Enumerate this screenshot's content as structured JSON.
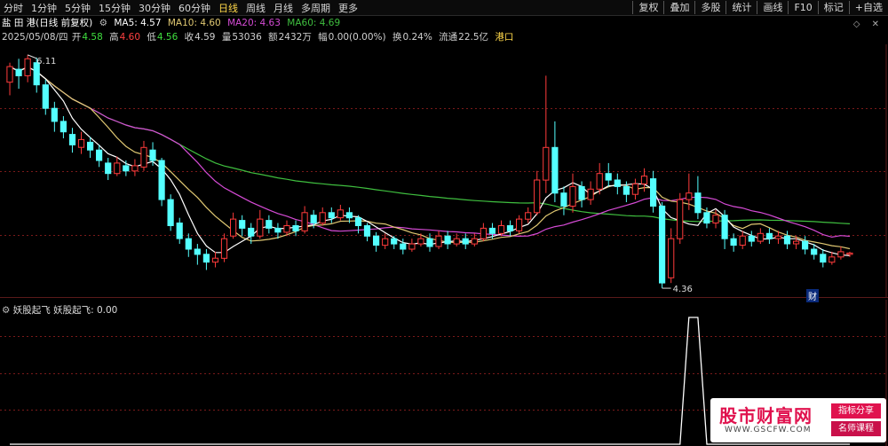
{
  "toolbar": {
    "periods": [
      "分时",
      "1分钟",
      "5分钟",
      "15分钟",
      "30分钟",
      "60分钟",
      "日线",
      "周线",
      "月线",
      "多周期",
      "更多"
    ],
    "active_period": "日线",
    "buttons": [
      "复权",
      "叠加",
      "多股",
      "统计",
      "画线",
      "F10",
      "标记",
      "+自选"
    ]
  },
  "stock": {
    "name": "盐 田 港(日线 前复权)",
    "ma5_label": "MA5: 4.57",
    "ma10_label": "MA10: 4.60",
    "ma20_label": "MA20: 4.63",
    "ma60_label": "MA60: 4.69"
  },
  "quote": {
    "date": "2025/05/08/四",
    "open_label": "开",
    "open": "4.58",
    "high_label": "高",
    "high": "4.60",
    "low_label": "低",
    "low": "4.56",
    "close_label": "收",
    "close": "4.59",
    "volume_label": "量",
    "volume": "53036",
    "amount_label": "额",
    "amount": "2432万",
    "change_label": "幅",
    "change": "0.00(0.00%)",
    "turnover_label": "换",
    "turnover": "0.24%",
    "float_label": "流通",
    "float": "22.5亿",
    "sector": "港口"
  },
  "annotations": {
    "max_price": "6.11",
    "min_price": "4.36",
    "finance_mark": "财"
  },
  "indicator": {
    "title": "妖股起飞",
    "value_label": "妖股起飞: 0.00"
  },
  "watermark": {
    "main": "股市财富网",
    "url": "WWW.GSCFW.COM",
    "tag1": "指标分享",
    "tag2": "名师课程"
  },
  "colors": {
    "up": "#ff3b3b",
    "down": "#54ffff",
    "ma5": "#ffffff",
    "ma10": "#e0c872",
    "ma20": "#d64bd6",
    "ma60": "#3fbf3f",
    "grid": "#7a1a1a"
  },
  "chart_data": {
    "type": "candlestick",
    "price_range": [
      4.3,
      6.15
    ],
    "candles": [
      [
        5.9,
        6.02,
        5.8,
        6.05
      ],
      [
        6.0,
        5.95,
        5.85,
        6.08
      ],
      [
        5.95,
        6.08,
        5.9,
        6.11
      ],
      [
        6.05,
        5.88,
        5.82,
        6.09
      ],
      [
        5.88,
        5.7,
        5.65,
        5.92
      ],
      [
        5.7,
        5.6,
        5.52,
        5.75
      ],
      [
        5.6,
        5.52,
        5.47,
        5.64
      ],
      [
        5.5,
        5.42,
        5.36,
        5.55
      ],
      [
        5.4,
        5.46,
        5.35,
        5.52
      ],
      [
        5.44,
        5.38,
        5.32,
        5.48
      ],
      [
        5.38,
        5.3,
        5.25,
        5.42
      ],
      [
        5.28,
        5.2,
        5.15,
        5.32
      ],
      [
        5.2,
        5.28,
        5.18,
        5.33
      ],
      [
        5.26,
        5.22,
        5.18,
        5.3
      ],
      [
        5.22,
        5.26,
        5.18,
        5.31
      ],
      [
        5.25,
        5.4,
        5.22,
        5.45
      ],
      [
        5.38,
        5.3,
        5.26,
        5.44
      ],
      [
        5.3,
        5.0,
        4.95,
        5.32
      ],
      [
        5.0,
        4.8,
        4.76,
        5.04
      ],
      [
        4.82,
        4.7,
        4.66,
        4.86
      ],
      [
        4.7,
        4.62,
        4.56,
        4.74
      ],
      [
        4.62,
        4.58,
        4.5,
        4.66
      ],
      [
        4.58,
        4.52,
        4.46,
        4.62
      ],
      [
        4.52,
        4.55,
        4.48,
        4.6
      ],
      [
        4.55,
        4.7,
        4.52,
        4.74
      ],
      [
        4.72,
        4.85,
        4.7,
        4.9
      ],
      [
        4.84,
        4.78,
        4.72,
        4.88
      ],
      [
        4.78,
        4.72,
        4.66,
        4.82
      ],
      [
        4.72,
        4.85,
        4.7,
        4.92
      ],
      [
        4.84,
        4.78,
        4.74,
        4.88
      ],
      [
        4.78,
        4.75,
        4.7,
        4.82
      ],
      [
        4.75,
        4.8,
        4.72,
        4.84
      ],
      [
        4.8,
        4.76,
        4.72,
        4.84
      ],
      [
        4.76,
        4.9,
        4.74,
        4.95
      ],
      [
        4.88,
        4.82,
        4.78,
        4.92
      ],
      [
        4.82,
        4.9,
        4.8,
        4.94
      ],
      [
        4.9,
        4.86,
        4.82,
        4.94
      ],
      [
        4.86,
        4.92,
        4.84,
        4.96
      ],
      [
        4.9,
        4.86,
        4.82,
        4.94
      ],
      [
        4.86,
        4.8,
        4.74,
        4.88
      ],
      [
        4.8,
        4.72,
        4.68,
        4.82
      ],
      [
        4.72,
        4.65,
        4.6,
        4.75
      ],
      [
        4.65,
        4.7,
        4.62,
        4.74
      ],
      [
        4.7,
        4.66,
        4.62,
        4.72
      ],
      [
        4.66,
        4.62,
        4.58,
        4.7
      ],
      [
        4.62,
        4.66,
        4.6,
        4.7
      ],
      [
        4.66,
        4.7,
        4.64,
        4.74
      ],
      [
        4.7,
        4.64,
        4.6,
        4.74
      ],
      [
        4.64,
        4.72,
        4.62,
        4.76
      ],
      [
        4.72,
        4.66,
        4.62,
        4.76
      ],
      [
        4.66,
        4.7,
        4.64,
        4.74
      ],
      [
        4.7,
        4.66,
        4.62,
        4.74
      ],
      [
        4.66,
        4.7,
        4.64,
        4.74
      ],
      [
        4.7,
        4.78,
        4.68,
        4.82
      ],
      [
        4.78,
        4.74,
        4.7,
        4.82
      ],
      [
        4.74,
        4.8,
        4.72,
        4.84
      ],
      [
        4.8,
        4.76,
        4.72,
        4.84
      ],
      [
        4.76,
        4.85,
        4.74,
        4.88
      ],
      [
        4.85,
        4.9,
        4.82,
        4.94
      ],
      [
        4.9,
        5.15,
        4.88,
        5.22
      ],
      [
        5.15,
        5.4,
        5.05,
        5.95
      ],
      [
        5.4,
        5.05,
        4.98,
        5.6
      ],
      [
        5.05,
        4.95,
        4.88,
        5.1
      ],
      [
        4.95,
        5.1,
        4.9,
        5.2
      ],
      [
        5.1,
        5.0,
        4.94,
        5.14
      ],
      [
        5.0,
        5.08,
        4.96,
        5.14
      ],
      [
        5.08,
        5.2,
        5.04,
        5.28
      ],
      [
        5.2,
        5.15,
        5.1,
        5.28
      ],
      [
        5.15,
        5.1,
        5.04,
        5.2
      ],
      [
        5.1,
        5.04,
        4.98,
        5.14
      ],
      [
        5.04,
        5.12,
        5.0,
        5.16
      ],
      [
        5.12,
        5.18,
        5.06,
        5.24
      ],
      [
        5.16,
        4.95,
        4.9,
        5.22
      ],
      [
        4.95,
        4.36,
        4.32,
        4.98
      ],
      [
        4.4,
        4.7,
        4.36,
        4.78
      ],
      [
        4.7,
        5.0,
        4.66,
        5.05
      ],
      [
        5.0,
        5.05,
        4.92,
        5.2
      ],
      [
        5.05,
        4.9,
        4.85,
        5.18
      ],
      [
        4.9,
        4.82,
        4.78,
        4.94
      ],
      [
        4.82,
        4.88,
        4.78,
        4.92
      ],
      [
        4.88,
        4.7,
        4.62,
        4.92
      ],
      [
        4.7,
        4.65,
        4.6,
        4.74
      ],
      [
        4.65,
        4.72,
        4.62,
        4.76
      ],
      [
        4.72,
        4.68,
        4.64,
        4.76
      ],
      [
        4.68,
        4.74,
        4.66,
        4.78
      ],
      [
        4.74,
        4.7,
        4.66,
        4.78
      ],
      [
        4.7,
        4.72,
        4.66,
        4.76
      ],
      [
        4.72,
        4.66,
        4.62,
        4.76
      ],
      [
        4.66,
        4.68,
        4.62,
        4.72
      ],
      [
        4.68,
        4.62,
        4.58,
        4.72
      ],
      [
        4.62,
        4.58,
        4.54,
        4.66
      ],
      [
        4.58,
        4.52,
        4.48,
        4.62
      ],
      [
        4.52,
        4.56,
        4.5,
        4.6
      ],
      [
        4.56,
        4.6,
        4.54,
        4.64
      ],
      [
        4.58,
        4.59,
        4.56,
        4.6
      ]
    ],
    "indicator_values": [
      0,
      0,
      0,
      0,
      0,
      0,
      0,
      0,
      0,
      0,
      0,
      0,
      0,
      0,
      0,
      0,
      0,
      0,
      0,
      0,
      0,
      0,
      0,
      0,
      0,
      0,
      0,
      0,
      0,
      0,
      0,
      0,
      0,
      0,
      0,
      0,
      0,
      0,
      0,
      0,
      0,
      0,
      0,
      0,
      0,
      0,
      0,
      0,
      0,
      0,
      0,
      0,
      0,
      0,
      0,
      0,
      0,
      0,
      0,
      0,
      0,
      0,
      0,
      0,
      0,
      0,
      0,
      0,
      0,
      0,
      0,
      0,
      0,
      0,
      0,
      0,
      1,
      1,
      0,
      0,
      0,
      0,
      0,
      0,
      0,
      0,
      0,
      0,
      0,
      0,
      0,
      0,
      0,
      0,
      0
    ]
  }
}
